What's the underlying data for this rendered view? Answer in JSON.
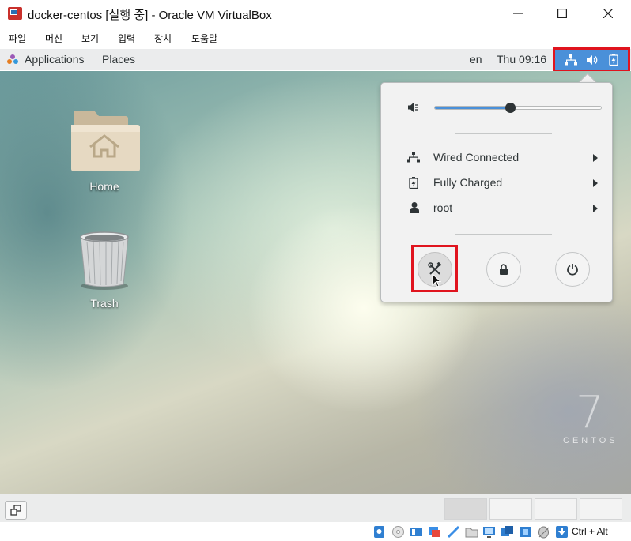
{
  "window": {
    "title": "docker-centos [실행 중] - Oracle VM VirtualBox",
    "menu": [
      "파일",
      "머신",
      "보기",
      "입력",
      "장치",
      "도움말"
    ]
  },
  "gnome_panel": {
    "applications": "Applications",
    "places": "Places",
    "language": "en",
    "clock": "Thu 09:16"
  },
  "desktop": {
    "icons": [
      {
        "label": "Home",
        "icon": "home-folder-icon"
      },
      {
        "label": "Trash",
        "icon": "trash-icon"
      }
    ],
    "brand_number": "7",
    "brand_word": "CENTOS"
  },
  "status_menu": {
    "volume_level_percent": 45,
    "rows": [
      {
        "label": "Wired Connected",
        "icon": "network-wired-icon"
      },
      {
        "label": "Fully Charged",
        "icon": "battery-icon"
      },
      {
        "label": "root",
        "icon": "user-icon"
      }
    ],
    "buttons": [
      "settings-icon",
      "lock-icon",
      "power-icon"
    ]
  },
  "vbox_status": {
    "host_key": "Ctrl + Alt"
  },
  "colors": {
    "panel_highlight": "#4a90d9",
    "annotation_red": "#e0141e"
  }
}
